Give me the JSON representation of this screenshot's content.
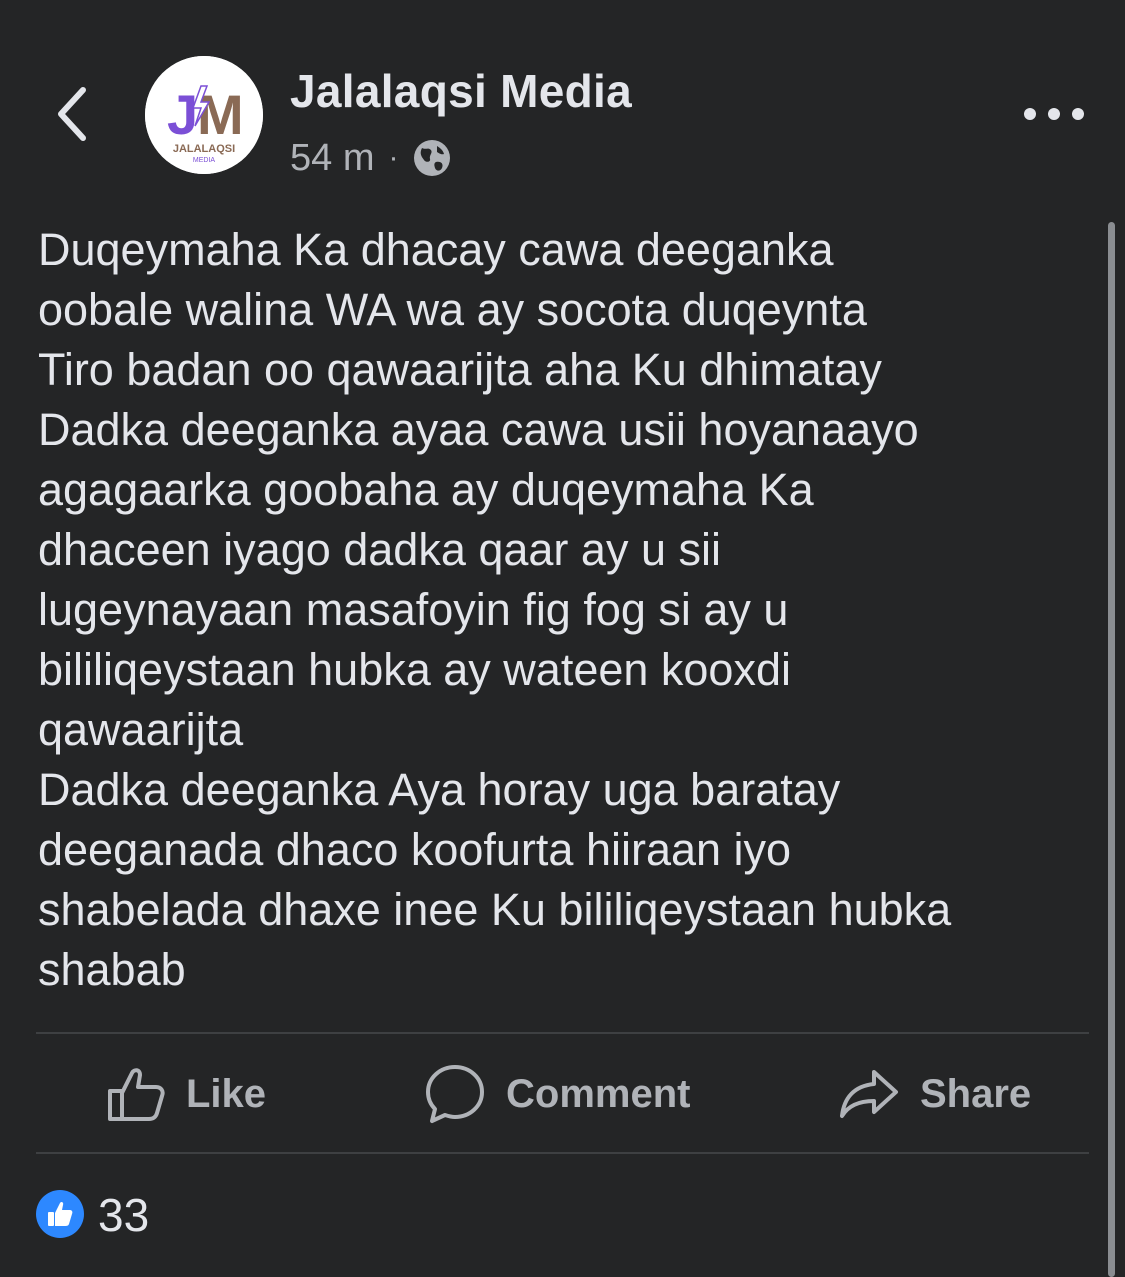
{
  "header": {
    "page_name": "Jalalaqsi Media",
    "time_ago": "54 m",
    "separator": "·",
    "privacy_icon": "globe-icon",
    "back_icon": "chevron-left-icon",
    "more_icon": "more-horizontal-icon"
  },
  "avatar": {
    "logo_letters": "JM",
    "logo_name": "JALALAQSI",
    "logo_sub": "MEDIA"
  },
  "post": {
    "text": "Duqeymaha Ka dhacay cawa deeganka\noobale walina WA wa ay socota duqeynta\nTiro badan oo qawaarijta aha Ku dhimatay\nDadka deeganka ayaa cawa usii hoyanaayo\nagagaarka goobaha ay duqeymaha Ka\ndhaceen iyago dadka qaar ay u sii\nlugeynayaan masafoyin fig fog si ay u\nbililiqeystaan hubka ay wateen kooxdi\nqawaarijta\nDadka deeganka Aya horay uga baratay\ndeeganada dhaco koofurta hiiraan iyo\nshabelada dhaxe inee Ku bililiqeystaan hubka\nshabab"
  },
  "actions": {
    "like": "Like",
    "comment": "Comment",
    "share": "Share"
  },
  "reactions": {
    "count": "33",
    "icon": "like-reaction-icon"
  },
  "colors": {
    "background": "#242526",
    "text_primary": "#e4e6eb",
    "text_secondary": "#b0b3b8",
    "divider": "#3e4042",
    "like_blue": "#2d88ff",
    "logo_purple": "#7b4fd6",
    "logo_brown": "#8a6a55"
  }
}
